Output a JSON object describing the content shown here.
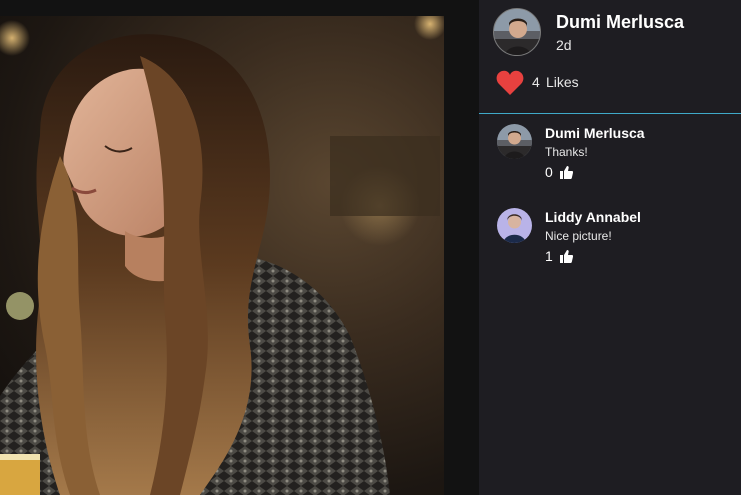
{
  "post": {
    "author": "Dumi Merlusca",
    "time": "2d",
    "likes_count": "4",
    "likes_label": "Likes"
  },
  "comments": [
    {
      "author": "Dumi Merlusca",
      "text": "Thanks!",
      "likes": "0"
    },
    {
      "author": "Liddy Annabel",
      "text": "Nice picture!",
      "likes": "1"
    }
  ],
  "icons": {
    "like": "heart-icon",
    "comment_like": "thumbs-up-icon"
  },
  "colors": {
    "panel_bg": "#1e1d22",
    "heart": "#e8413f",
    "divider": "#3fa9c9",
    "page_bg": "#131313"
  }
}
